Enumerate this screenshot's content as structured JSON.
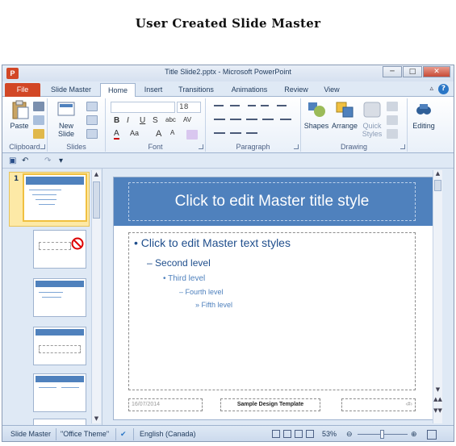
{
  "page_heading": "User Created Slide Master",
  "window": {
    "title": "Title Slide2.pptx - Microsoft PowerPoint",
    "app_icon": "P",
    "minimize": "─",
    "maximize": "□",
    "close": "✕"
  },
  "tabs": [
    "File",
    "Slide Master",
    "Home",
    "Insert",
    "Transitions",
    "Animations",
    "Review",
    "View"
  ],
  "ribbon": {
    "clipboard": {
      "label": "Clipboard",
      "paste": "Paste"
    },
    "slides": {
      "label": "Slides",
      "new_slide": "New",
      "new_slide_2": "Slide"
    },
    "font": {
      "label": "Font",
      "size": "18",
      "bold": "B",
      "italic": "I",
      "underline": "U",
      "strike": "S",
      "shadow": "abc",
      "spacing": "AV",
      "font_color": "A",
      "change_case": "Aa",
      "grow": "A",
      "shrink": "A"
    },
    "paragraph": {
      "label": "Paragraph"
    },
    "drawing": {
      "label": "Drawing",
      "shapes": "Shapes",
      "arrange": "Arrange",
      "quick_styles": "Quick",
      "quick_styles_2": "Styles"
    },
    "editing": {
      "label": "Editing"
    }
  },
  "qat": {
    "save": "💾",
    "undo": "↶",
    "redo": "↷",
    "customize": "▾"
  },
  "thumbnails": {
    "master_number": "1",
    "master_title": "Click to edit Master title style"
  },
  "slide": {
    "title": "Click to edit Master title style",
    "levels": [
      "Click to edit Master text styles",
      "Second level",
      "Third level",
      "Fourth level",
      "Fifth level"
    ],
    "footer_date": "16/07/2014",
    "footer_text": "Sample Design Template",
    "footer_number": "‹#›"
  },
  "status": {
    "view": "Slide Master",
    "theme": "\"Office Theme\"",
    "language": "English (Canada)",
    "zoom": "53%",
    "zoom_level_percent": 53
  },
  "colors": {
    "accent": "#4f81bd",
    "file_tab": "#d24726",
    "selection": "#fde9a6"
  }
}
